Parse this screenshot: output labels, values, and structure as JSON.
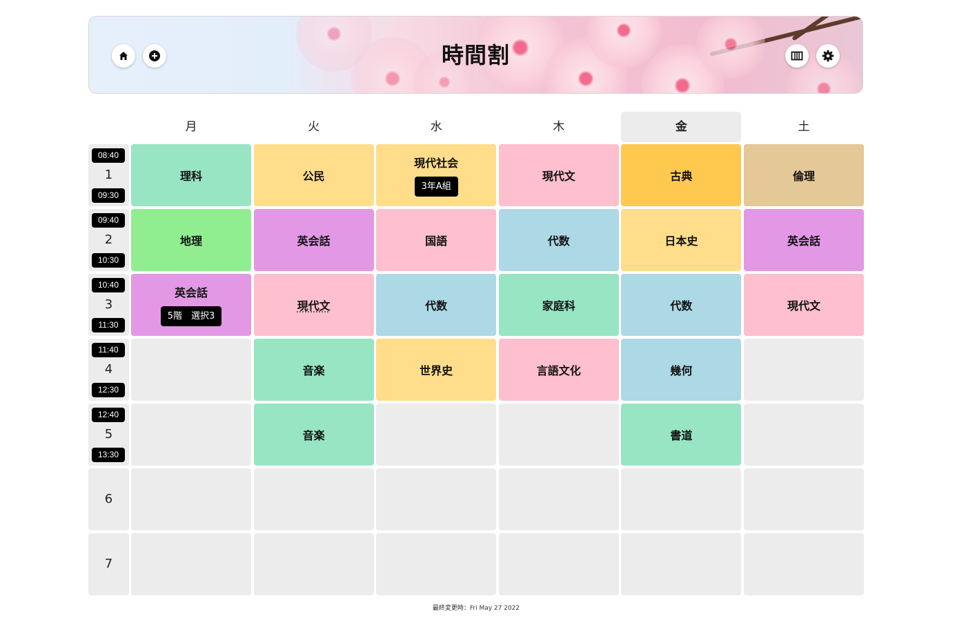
{
  "header": {
    "title": "時間割",
    "icons": {
      "home": "home-icon",
      "add": "plus-circle-icon",
      "view": "columns-icon",
      "settings": "gear-icon"
    }
  },
  "days": [
    "月",
    "火",
    "水",
    "木",
    "金",
    "土"
  ],
  "today_index": 4,
  "periods": [
    {
      "num": "1",
      "start": "08:40",
      "end": "09:30"
    },
    {
      "num": "2",
      "start": "09:40",
      "end": "10:30"
    },
    {
      "num": "3",
      "start": "10:40",
      "end": "11:30"
    },
    {
      "num": "4",
      "start": "11:40",
      "end": "12:30"
    },
    {
      "num": "5",
      "start": "12:40",
      "end": "13:30"
    },
    {
      "num": "6",
      "start": "",
      "end": ""
    },
    {
      "num": "7",
      "start": "",
      "end": ""
    }
  ],
  "timetable": [
    [
      {
        "subject": "理科",
        "color": "#98e5c4"
      },
      {
        "subject": "公民",
        "color": "#ffdd8a"
      },
      {
        "subject": "現代社会",
        "color": "#ffdd8a",
        "note": "3年A組"
      },
      {
        "subject": "現代文",
        "color": "#fec0ce"
      },
      {
        "subject": "古典",
        "color": "#ffc84f"
      },
      {
        "subject": "倫理",
        "color": "#e4c898"
      }
    ],
    [
      {
        "subject": "地理",
        "color": "#90ee90"
      },
      {
        "subject": "英会話",
        "color": "#e298e5"
      },
      {
        "subject": "国語",
        "color": "#fec0ce"
      },
      {
        "subject": "代数",
        "color": "#add8e6"
      },
      {
        "subject": "日本史",
        "color": "#ffdd8a"
      },
      {
        "subject": "英会話",
        "color": "#e298e5"
      }
    ],
    [
      {
        "subject": "英会話",
        "color": "#e298e5",
        "note": "5階　選択3"
      },
      {
        "subject": "現代文",
        "color": "#fec0ce",
        "dotted": true
      },
      {
        "subject": "代数",
        "color": "#add8e6"
      },
      {
        "subject": "家庭科",
        "color": "#98e5c4"
      },
      {
        "subject": "代数",
        "color": "#add8e6"
      },
      {
        "subject": "現代文",
        "color": "#fec0ce"
      }
    ],
    [
      {
        "subject": "",
        "color": "#ececec"
      },
      {
        "subject": "音楽",
        "color": "#98e5c4"
      },
      {
        "subject": "世界史",
        "color": "#ffdd8a"
      },
      {
        "subject": "言語文化",
        "color": "#fec0ce"
      },
      {
        "subject": "幾何",
        "color": "#add8e6"
      },
      {
        "subject": "",
        "color": "#ececec"
      }
    ],
    [
      {
        "subject": "",
        "color": "#ececec"
      },
      {
        "subject": "音楽",
        "color": "#98e5c4"
      },
      {
        "subject": "",
        "color": "#ececec"
      },
      {
        "subject": "",
        "color": "#ececec"
      },
      {
        "subject": "書道",
        "color": "#98e5c4"
      },
      {
        "subject": "",
        "color": "#ececec"
      }
    ],
    [
      {
        "subject": "",
        "color": "#ececec"
      },
      {
        "subject": "",
        "color": "#ececec"
      },
      {
        "subject": "",
        "color": "#ececec"
      },
      {
        "subject": "",
        "color": "#ececec"
      },
      {
        "subject": "",
        "color": "#ececec"
      },
      {
        "subject": "",
        "color": "#ececec"
      }
    ],
    [
      {
        "subject": "",
        "color": "#ececec"
      },
      {
        "subject": "",
        "color": "#ececec"
      },
      {
        "subject": "",
        "color": "#ececec"
      },
      {
        "subject": "",
        "color": "#ececec"
      },
      {
        "subject": "",
        "color": "#ececec"
      },
      {
        "subject": "",
        "color": "#ececec"
      }
    ]
  ],
  "footer": {
    "label": "最終変更時：",
    "value": "Fri May 27 2022"
  }
}
